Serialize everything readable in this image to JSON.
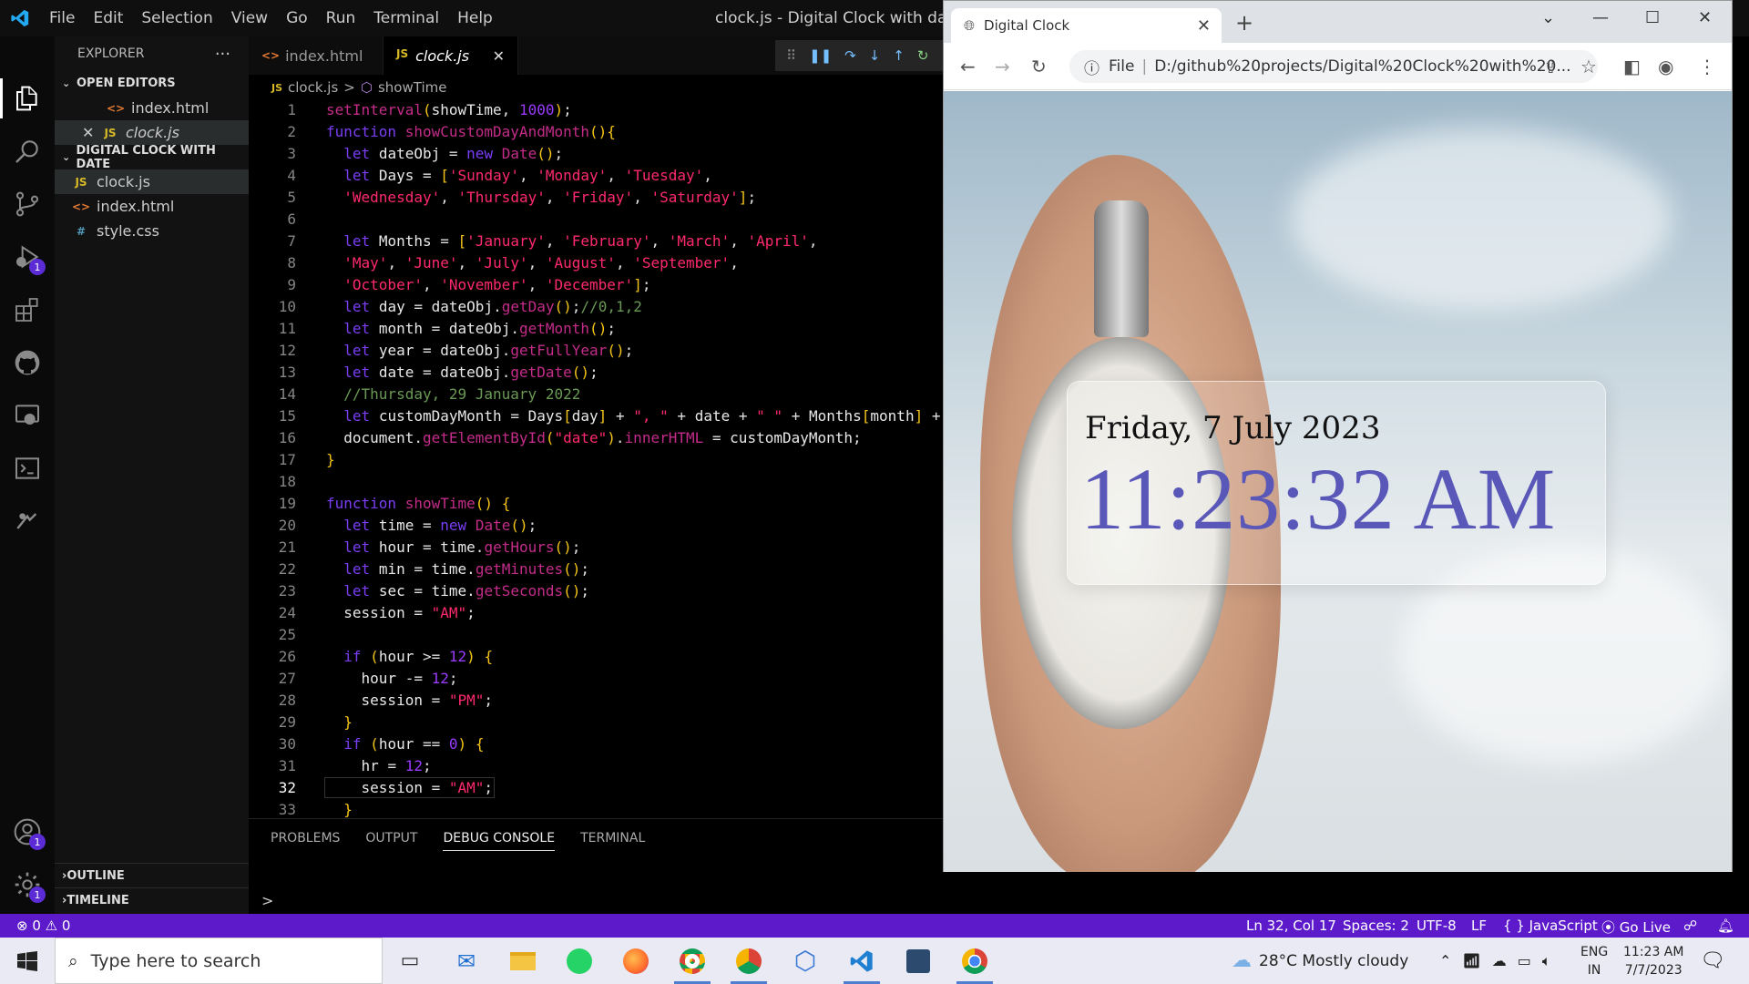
{
  "window_title": "clock.js - Digital Clock with date - Visual Studio Code",
  "menu": [
    "File",
    "Edit",
    "Selection",
    "View",
    "Go",
    "Run",
    "Terminal",
    "Help"
  ],
  "explorer": {
    "title": "EXPLORER",
    "more": "···",
    "open_editors": "OPEN EDITORS",
    "project": "DIGITAL CLOCK WITH DATE",
    "open_files": [
      {
        "name": "index.html",
        "type": "html"
      },
      {
        "name": "clock.js",
        "type": "js"
      }
    ],
    "files": [
      {
        "name": "clock.js",
        "type": "js"
      },
      {
        "name": "index.html",
        "type": "html"
      },
      {
        "name": "style.css",
        "type": "css"
      }
    ],
    "outline": "OUTLINE",
    "timeline": "TIMELINE"
  },
  "badges": {
    "debug": "1",
    "accounts": "1",
    "settings": "1"
  },
  "tabs": [
    {
      "label": "index.html",
      "icon": "<>"
    },
    {
      "label": "clock.js",
      "icon": "JS",
      "close": "✕"
    }
  ],
  "breadcrumb": {
    "file": "clock.js",
    "sep": ">",
    "symbol": "showTime"
  },
  "code_lines": [
    "setInterval(showTime, 1000);",
    "function showCustomDayAndMonth(){",
    "  let dateObj = new Date();",
    "  let Days = ['Sunday', 'Monday', 'Tuesday',",
    "  'Wednesday', 'Thursday', 'Friday', 'Saturday'];",
    "",
    "  let Months = ['January', 'February', 'March', 'April',",
    "  'May', 'June', 'July', 'August', 'September',",
    "  'October', 'November', 'December'];",
    "  let day = dateObj.getDay();//0,1,2",
    "  let month = dateObj.getMonth();",
    "  let year = dateObj.getFullYear();",
    "  let date = dateObj.getDate();",
    "  //Thursday, 29 January 2022",
    "  let customDayMonth = Days[day] + \", \" + date + \" \" + Months[month] +",
    "  document.getElementById(\"date\").innerHTML = customDayMonth;",
    "}",
    "",
    "function showTime() {",
    "  let time = new Date();",
    "  let hour = time.getHours();",
    "  let min = time.getMinutes();",
    "  let sec = time.getSeconds();",
    "  session = \"AM\";",
    "",
    "  if (hour >= 12) {",
    "    hour -= 12;",
    "    session = \"PM\";",
    "  }",
    "  if (hour == 0) {",
    "    hr = 12;",
    "    session = \"AM\";",
    "  }"
  ],
  "line_numbers": [
    "1",
    "2",
    "3",
    "4",
    "5",
    "6",
    "7",
    "8",
    "9",
    "10",
    "11",
    "12",
    "13",
    "14",
    "15",
    "16",
    "17",
    "18",
    "19",
    "20",
    "21",
    "22",
    "23",
    "24",
    "25",
    "26",
    "27",
    "28",
    "29",
    "30",
    "31",
    "32",
    "33"
  ],
  "panel_tabs": [
    "PROBLEMS",
    "OUTPUT",
    "DEBUG CONSOLE",
    "TERMINAL"
  ],
  "console_prompt": ">",
  "status": {
    "errors": "0",
    "warnings": "0",
    "position": "Ln 32, Col 17",
    "spaces": "Spaces: 2",
    "encoding": "UTF-8",
    "eol": "LF",
    "language": "JavaScript",
    "golive": "Go Live"
  },
  "browser": {
    "tab_title": "Digital Clock",
    "tab_close": "✕",
    "new_tab": "+",
    "address_prefix": "File",
    "address": "D:/github%20projects/Digital%20Clock%20with%20...",
    "date": "Friday, 7 July 2023",
    "time": "11:23:32 AM"
  },
  "taskbar": {
    "search_placeholder": "Type here to search",
    "weather": "28°C  Mostly cloudy",
    "lang1": "ENG",
    "lang2": "IN",
    "clock_time": "11:23 AM",
    "clock_date": "7/7/2023"
  },
  "colors": {
    "accent": "#5d1acb",
    "clock_text": "#5957b8"
  }
}
